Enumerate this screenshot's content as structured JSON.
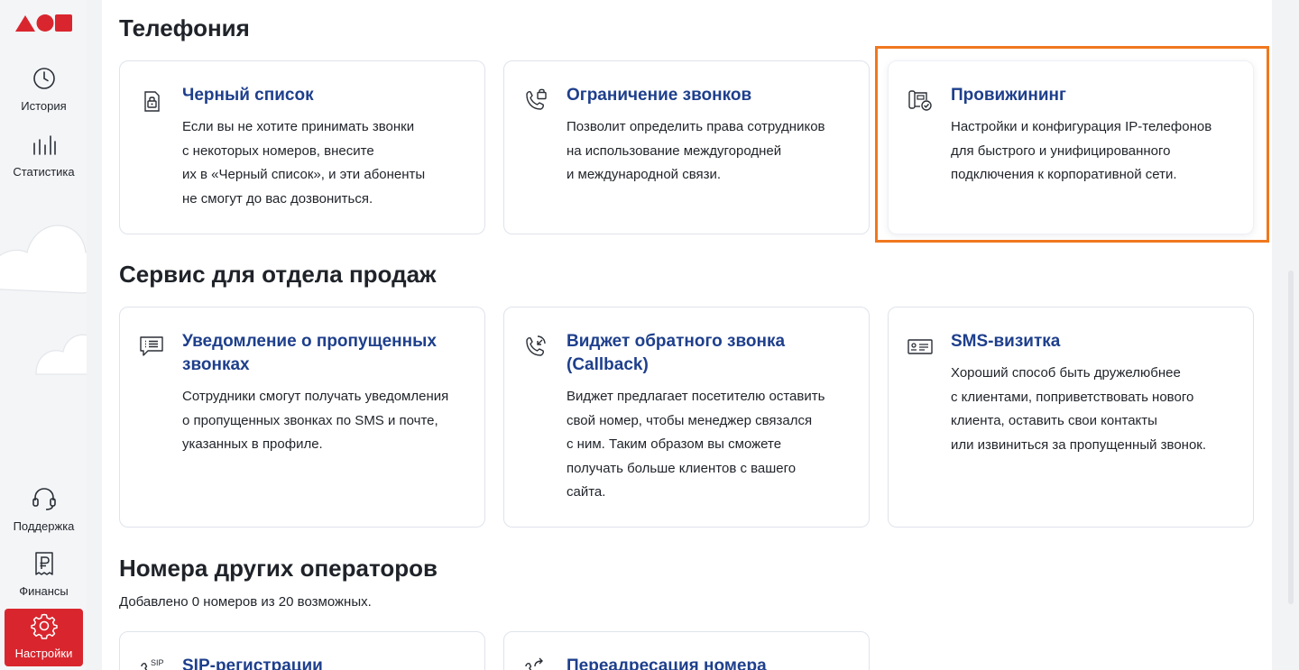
{
  "sidebar": {
    "nav": [
      {
        "label": "История",
        "icon": "clock-icon"
      },
      {
        "label": "Статистика",
        "icon": "bar-chart-icon"
      },
      {
        "label": "Поддержка",
        "icon": "headset-icon"
      },
      {
        "label": "Финансы",
        "icon": "ruble-receipt-icon"
      },
      {
        "label": "Настройки",
        "icon": "gear-icon",
        "active": true
      }
    ]
  },
  "sections": {
    "telephony": {
      "title": "Телефония",
      "cards": [
        {
          "title": "Черный список",
          "desc": [
            "Если вы не хотите принимать звонки",
            "с некоторых номеров, внесите",
            "их в «Черный список», и эти абоненты",
            "не смогут до вас дозвониться."
          ]
        },
        {
          "title": "Ограничение звонков",
          "desc": [
            "Позволит определить права сотрудников",
            "на использование междугородней",
            "и международной связи."
          ]
        },
        {
          "title": "Провижининг",
          "desc": [
            "Настройки и конфигурация IP-телефонов",
            "для быстрого и унифицированного",
            "подключения к корпоративной сети."
          ]
        }
      ]
    },
    "sales": {
      "title": "Сервис для отдела продаж",
      "cards": [
        {
          "title": "Уведомление о пропущенных звонках",
          "desc": [
            "Сотрудники смогут получать уведомления",
            "о пропущенных звонках по SMS и почте,",
            "указанных в профиле."
          ]
        },
        {
          "title": "Виджет обратного звонка (Callback)",
          "desc": [
            "Виджет предлагает посетителю оставить",
            "свой номер, чтобы менеджер связался",
            "с ним. Таким образом вы сможете",
            "получать больше клиентов с вашего",
            "сайта."
          ]
        },
        {
          "title": "SMS-визитка",
          "desc": [
            "Хороший способ быть дружелюбнее",
            "с клиентами, поприветствовать нового",
            "клиента, оставить свои контакты",
            "или извиниться за пропущенный звонок."
          ]
        }
      ]
    },
    "operators": {
      "title": "Номера других операторов",
      "subtitle": "Добавлено 0 номеров из 20 возможных.",
      "cards": [
        {
          "title": "SIP-регистрации",
          "icon_text": "SIP"
        },
        {
          "title": "Переадресация номера"
        }
      ]
    }
  },
  "colors": {
    "accent": "#d9262e",
    "title_blue": "#1e3f8c",
    "highlight": "#f0781e"
  }
}
